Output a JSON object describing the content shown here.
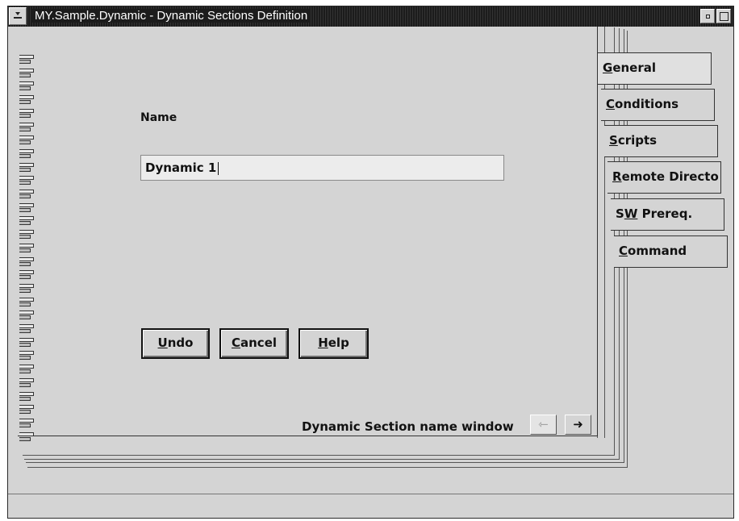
{
  "window": {
    "title": "MY.Sample.Dynamic - Dynamic Sections Definition"
  },
  "form": {
    "name_label": "Name",
    "name_value": "Dynamic 1"
  },
  "buttons": {
    "undo": {
      "mnemonic": "U",
      "rest": "ndo"
    },
    "cancel": {
      "mnemonic": "C",
      "rest": "ancel"
    },
    "help": {
      "mnemonic": "H",
      "rest": "elp"
    }
  },
  "tabs": [
    {
      "pre": "",
      "mnemonic": "G",
      "rest": "eneral"
    },
    {
      "pre": "",
      "mnemonic": "C",
      "rest": "onditions"
    },
    {
      "pre": "",
      "mnemonic": "S",
      "rest": "cripts"
    },
    {
      "pre": "",
      "mnemonic": "R",
      "rest": "emote Directo"
    },
    {
      "pre": "S",
      "mnemonic": "W",
      "rest": " Prereq."
    },
    {
      "pre": "",
      "mnemonic": "C",
      "rest": "ommand"
    }
  ],
  "page_status": "Dynamic Section name window",
  "nav": {
    "prev_icon": "left-arrow-icon",
    "next_icon": "right-arrow-icon",
    "prev_glyph": "⇽",
    "next_glyph": "➜"
  }
}
